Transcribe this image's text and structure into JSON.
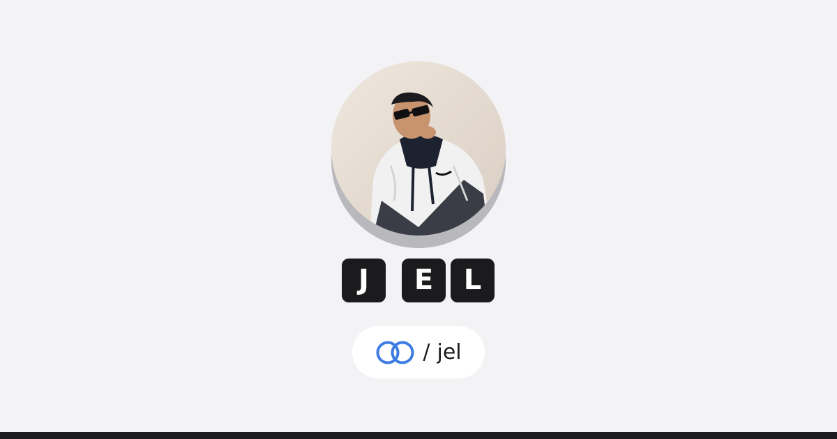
{
  "profile": {
    "name_letters": [
      "J",
      "E",
      "L"
    ],
    "handle_prefix": "/",
    "handle": "jel",
    "avatar_alt": "profile photo"
  },
  "icons": {
    "avatar": "avatar-photo",
    "link": "linked-rings-icon"
  },
  "colors": {
    "background": "#f3f3f6",
    "tile": "#1b1b1d",
    "tile_text": "#ffffff",
    "pill": "#ffffff",
    "link_icon": "#3d7ce3",
    "bottom_bar": "#1c1c1f"
  }
}
